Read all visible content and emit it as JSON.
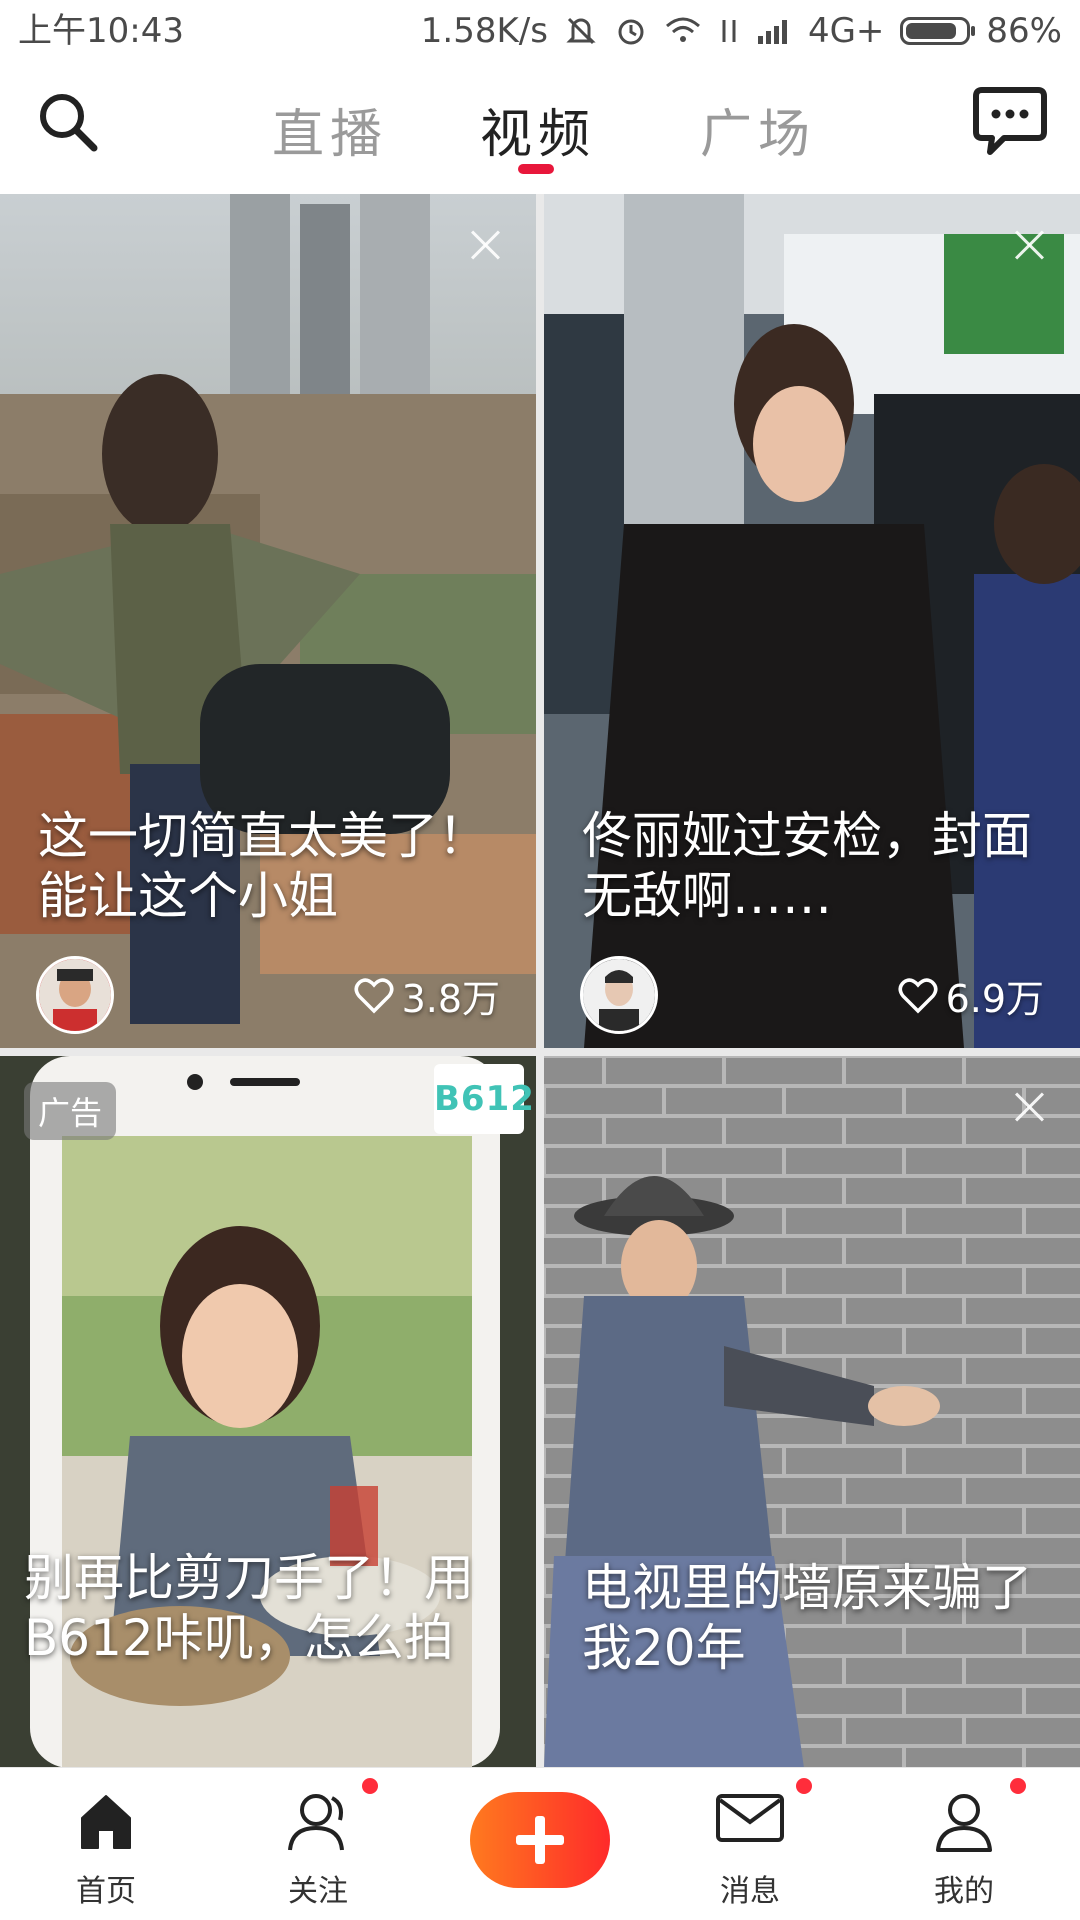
{
  "status_bar": {
    "time": "上午10:43",
    "speed": "1.58K/s",
    "network": "4G+",
    "battery_percent": "86%",
    "battery_level": 0.86
  },
  "top_nav": {
    "tabs": [
      {
        "label": "直播"
      },
      {
        "label": "视频",
        "active": true
      },
      {
        "label": "广场"
      }
    ]
  },
  "feed": [
    {
      "title": "这一切简直太美了！能让这个小姐",
      "likes": "3.8万"
    },
    {
      "title": "佟丽娅过安检，封面无敌啊……",
      "likes": "6.9万"
    },
    {
      "title": "别再比剪刀手了！用B612咔叽，怎么拍",
      "ad_label": "广告",
      "brand": "B612"
    },
    {
      "title": "电视里的墙原来骗了我20年"
    }
  ],
  "bottom_nav": {
    "items": [
      {
        "label": "首页",
        "icon": "home-icon",
        "badge": false
      },
      {
        "label": "关注",
        "icon": "user-follow-icon",
        "badge": true
      },
      {
        "label": "",
        "icon": "plus-icon",
        "badge": false
      },
      {
        "label": "消息",
        "icon": "mail-icon",
        "badge": true
      },
      {
        "label": "我的",
        "icon": "profile-icon",
        "badge": true
      }
    ]
  },
  "colors": {
    "accent": "#e8173b",
    "badge": "#ff2d3b",
    "plus_gradient_start": "#ff7a1f",
    "plus_gradient_end": "#ff2a2a"
  }
}
